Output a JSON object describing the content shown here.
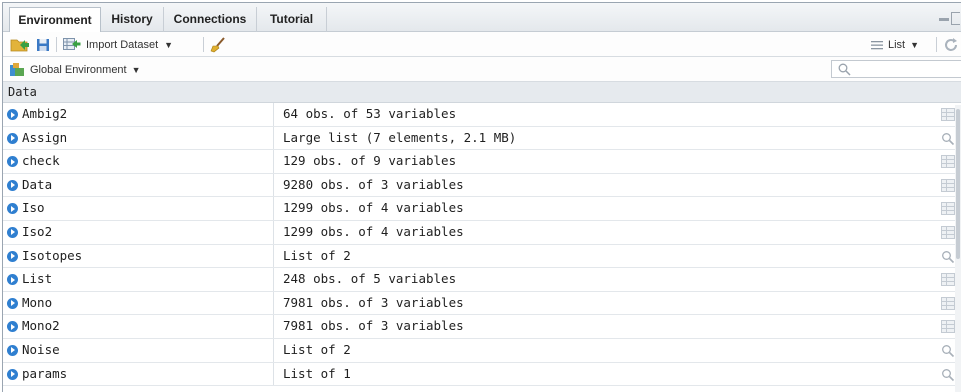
{
  "tabs": [
    {
      "label": "Environment",
      "active": true
    },
    {
      "label": "History",
      "active": false
    },
    {
      "label": "Connections",
      "active": false
    },
    {
      "label": "Tutorial",
      "active": false
    }
  ],
  "toolbar": {
    "import_label": "Import Dataset",
    "view_label": "List"
  },
  "env": {
    "label": "Global Environment",
    "search_placeholder": ""
  },
  "section": {
    "title": "Data"
  },
  "rows": [
    {
      "name": "Ambig2",
      "value": "64 obs. of 53 variables",
      "action": "grid"
    },
    {
      "name": "Assign",
      "value": "Large list (7 elements, 2.1 MB)",
      "action": "search"
    },
    {
      "name": "check",
      "value": "129 obs. of 9 variables",
      "action": "grid"
    },
    {
      "name": "Data",
      "value": "9280 obs. of 3 variables",
      "action": "grid"
    },
    {
      "name": "Iso",
      "value": "1299 obs. of 4 variables",
      "action": "grid"
    },
    {
      "name": "Iso2",
      "value": "1299 obs. of 4 variables",
      "action": "grid"
    },
    {
      "name": "Isotopes",
      "value": "List of 2",
      "action": "search"
    },
    {
      "name": "List",
      "value": "248 obs. of 5 variables",
      "action": "grid"
    },
    {
      "name": "Mono",
      "value": "7981 obs. of 3 variables",
      "action": "grid"
    },
    {
      "name": "Mono2",
      "value": "7981 obs. of 3 variables",
      "action": "grid"
    },
    {
      "name": "Noise",
      "value": "List of 2",
      "action": "search"
    },
    {
      "name": "params",
      "value": "List of 1",
      "action": "search"
    }
  ]
}
